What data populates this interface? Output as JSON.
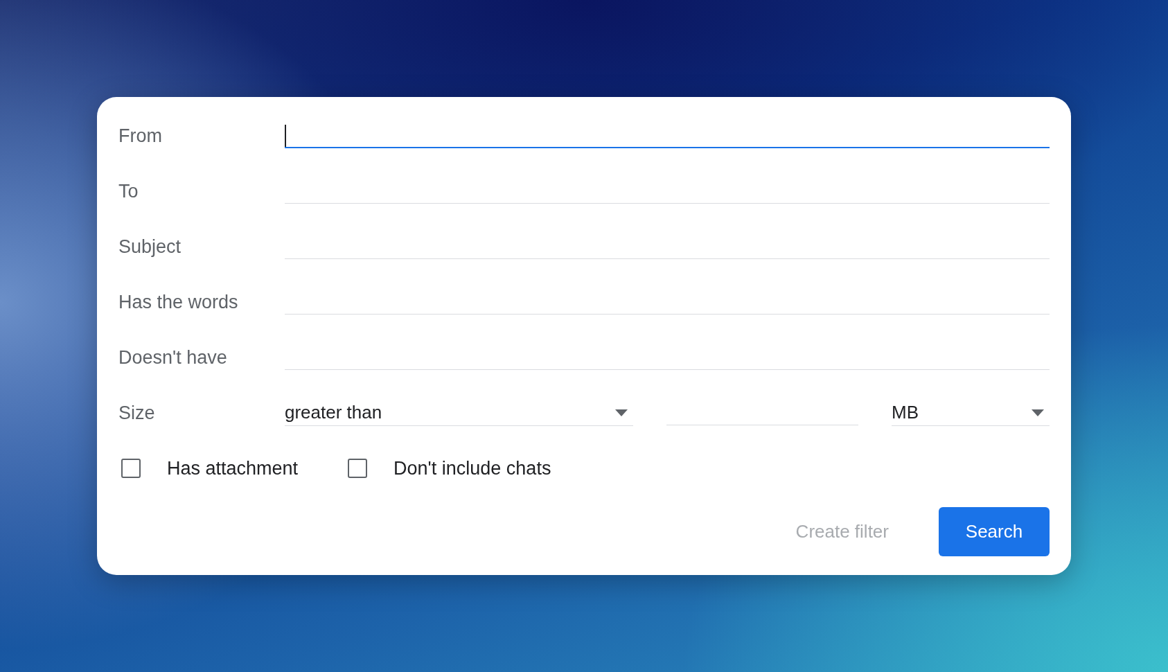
{
  "fields": [
    {
      "label": "From",
      "focused": true
    },
    {
      "label": "To",
      "focused": false
    },
    {
      "label": "Subject",
      "focused": false
    },
    {
      "label": "Has the words",
      "focused": false
    },
    {
      "label": "Doesn't have",
      "focused": false
    }
  ],
  "size": {
    "label": "Size",
    "operator": "greater than",
    "unit": "MB"
  },
  "checkboxes": [
    {
      "label": "Has attachment",
      "checked": false
    },
    {
      "label": "Don't include chats",
      "checked": false
    }
  ],
  "buttons": [
    {
      "label": "Create filter",
      "kind": "text",
      "disabled": true
    },
    {
      "label": "Search",
      "kind": "filled",
      "disabled": false
    }
  ]
}
